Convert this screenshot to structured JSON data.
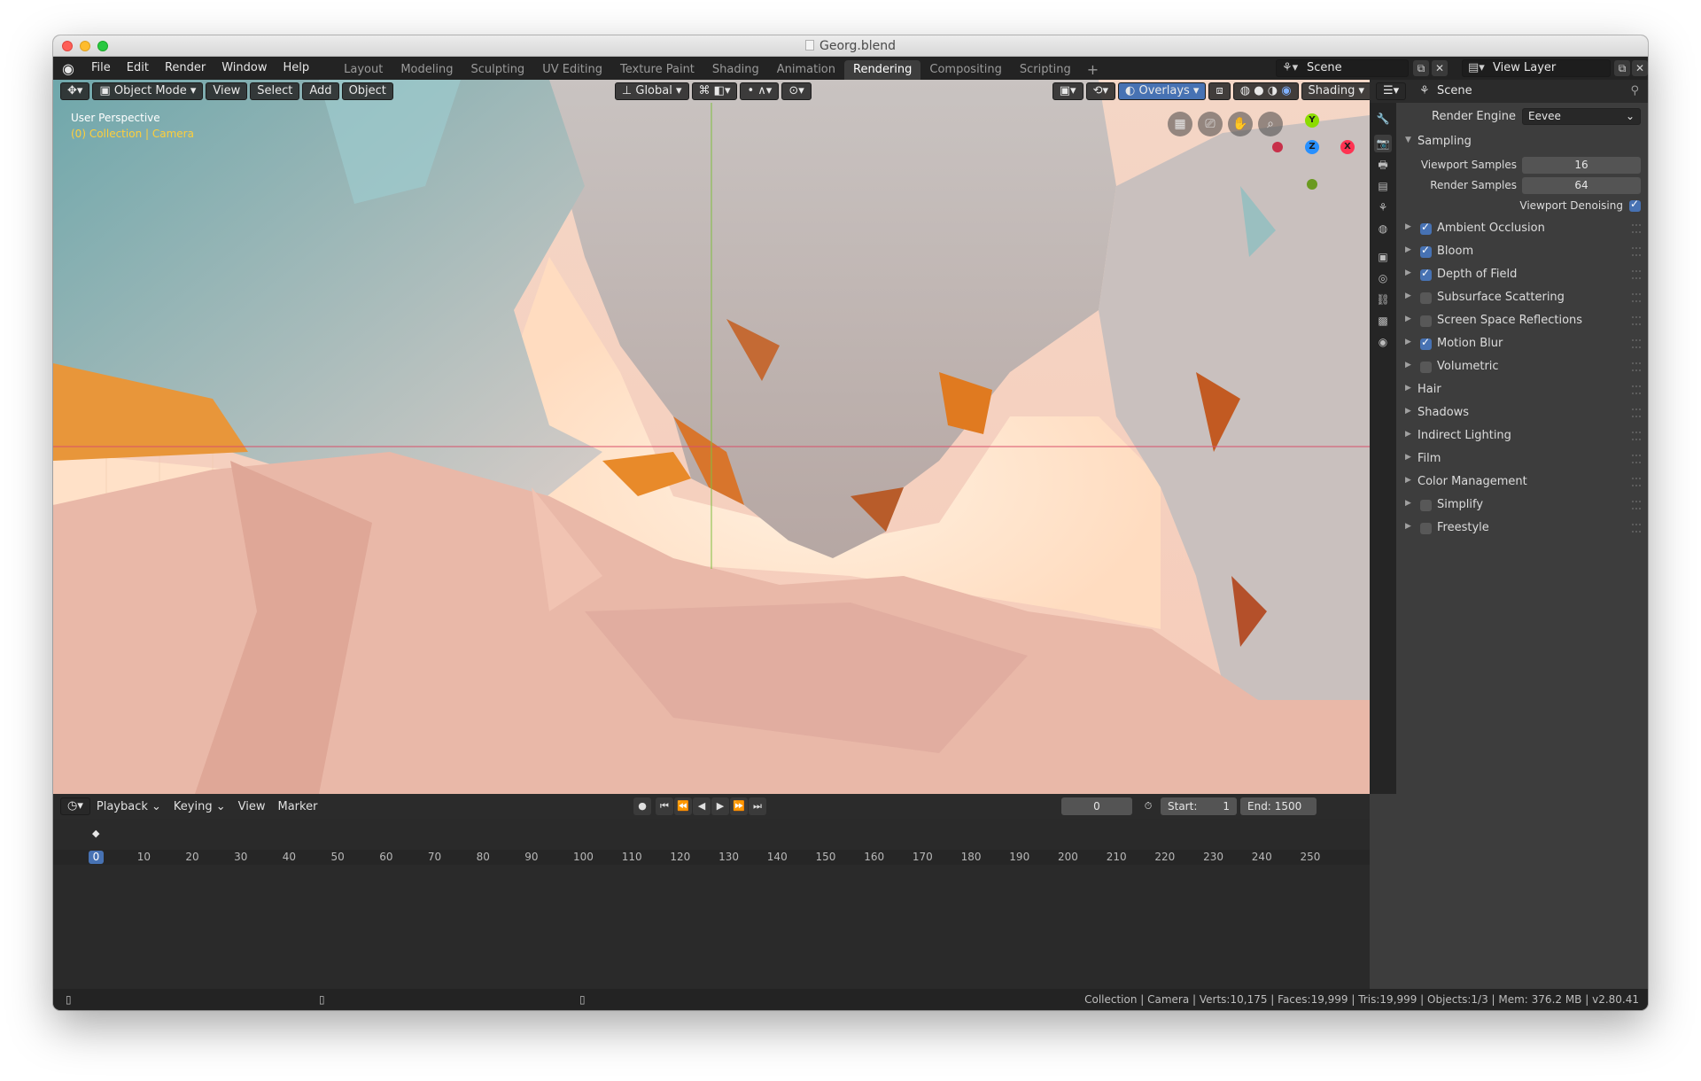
{
  "window": {
    "title": "Georg.blend"
  },
  "topbar": {
    "menus": [
      "File",
      "Edit",
      "Render",
      "Window",
      "Help"
    ],
    "tabs": [
      "Layout",
      "Modeling",
      "Sculpting",
      "UV Editing",
      "Texture Paint",
      "Shading",
      "Animation",
      "Rendering",
      "Compositing",
      "Scripting"
    ],
    "active_tab": "Rendering",
    "add_tab": "+",
    "scene": "Scene",
    "view_layer": "View Layer"
  },
  "viewport": {
    "mode": "Object Mode",
    "menus": [
      "View",
      "Select",
      "Add",
      "Object"
    ],
    "transform_orientation": "Global",
    "overlays_label": "Overlays",
    "shading_label": "Shading",
    "perspective_label": "User Perspective",
    "collection_label": "(0) Collection | Camera",
    "gizmo_axes": {
      "y": "Y",
      "z": "Z",
      "x": "X"
    },
    "colors": {
      "axis_x": "#ff3352",
      "axis_y": "#8bdc00",
      "axis_z": "#2890ff"
    }
  },
  "properties": {
    "context": "Scene",
    "render_engine_label": "Render Engine",
    "render_engine": "Eevee",
    "sampling": {
      "title": "Sampling",
      "viewport_samples_label": "Viewport Samples",
      "viewport_samples": "16",
      "render_samples_label": "Render Samples",
      "render_samples": "64",
      "denoising_label": "Viewport Denoising",
      "denoising": true
    },
    "sections": [
      {
        "label": "Ambient Occlusion",
        "checkbox": true,
        "checked": true
      },
      {
        "label": "Bloom",
        "checkbox": true,
        "checked": true
      },
      {
        "label": "Depth of Field",
        "checkbox": true,
        "checked": true
      },
      {
        "label": "Subsurface Scattering",
        "checkbox": true,
        "checked": false
      },
      {
        "label": "Screen Space Reflections",
        "checkbox": true,
        "checked": false
      },
      {
        "label": "Motion Blur",
        "checkbox": true,
        "checked": true
      },
      {
        "label": "Volumetric",
        "checkbox": true,
        "checked": false
      },
      {
        "label": "Hair",
        "checkbox": false,
        "checked": false
      },
      {
        "label": "Shadows",
        "checkbox": false,
        "checked": false
      },
      {
        "label": "Indirect Lighting",
        "checkbox": false,
        "checked": false
      },
      {
        "label": "Film",
        "checkbox": false,
        "checked": false
      },
      {
        "label": "Color Management",
        "checkbox": false,
        "checked": false
      },
      {
        "label": "Simplify",
        "checkbox": true,
        "checked": false
      },
      {
        "label": "Freestyle",
        "checkbox": true,
        "checked": false
      }
    ]
  },
  "timeline": {
    "menus": [
      "Playback",
      "Keying",
      "View",
      "Marker"
    ],
    "current_frame": "0",
    "start_label": "Start:",
    "start": "1",
    "end_label": "End:",
    "end": "1500",
    "ticks": [
      "0",
      "10",
      "20",
      "30",
      "40",
      "50",
      "60",
      "70",
      "80",
      "90",
      "100",
      "110",
      "120",
      "130",
      "140",
      "150",
      "160",
      "170",
      "180",
      "190",
      "200",
      "210",
      "220",
      "230",
      "240",
      "250"
    ]
  },
  "statusbar": {
    "stats": "Collection | Camera | Verts:10,175 | Faces:19,999 | Tris:19,999 | Objects:1/3 | Mem: 376.2 MB | v2.80.41"
  }
}
